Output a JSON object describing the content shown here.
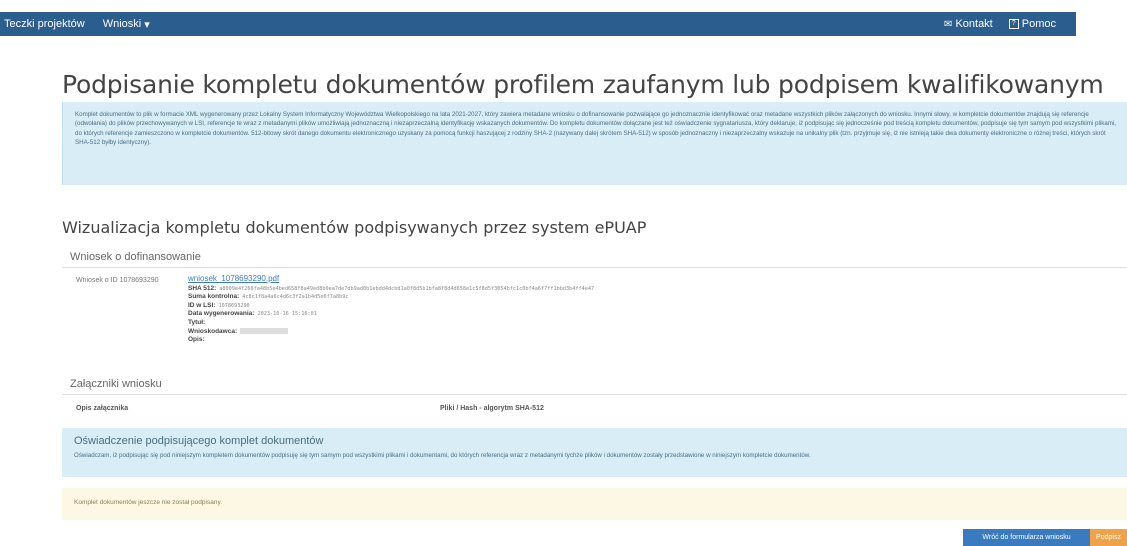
{
  "nav": {
    "left": [
      "Teczki projektów",
      "Wnioski"
    ],
    "wnioski_caret": "▾",
    "right": [
      {
        "icon": "envelope-icon",
        "label": "Kontakt"
      },
      {
        "icon": "help-box-icon",
        "label": "Pomoc"
      }
    ]
  },
  "page": {
    "title": "Podpisanie kompletu dokumentów profilem zaufanym lub podpisem kwalifikowanym przez ePUAP",
    "info": "Komplet dokumentów to plik w formacie XML wygenerowany przez Lokalny System Informatyczny Województwa Wielkopolskiego na lata 2021-2027, który zawiera metadane wniosku o dofinansowanie pozwalające go jednoznacznie identyfikować oraz metadane wszystkich plików załączonych do wniosku. Innymi słowy, w kompletcie dokumentów znajdują się referencje (odwołania) do plików przechowywanych w LSI, referencje te wraz z metadanymi plików umożliwiają jednoznaczną i niezaprzeczalną identyfikację wskazanych dokumentów. Do kompletu dokumentów dołączane jest też oświadczenie sygnatariusza, który deklaruje, iż podpisując się jednocześnie pod treścią kompletu dokumentów, podpisuje się tym samym pod wszystkimi plikami, do których referencje zamieszczono w kompletcie dokumentów. 512-bitowy skrót danego dokumentu elektronicznego uzyskany za pomocą funkcji haszującej z rodziny SHA-2 (nazywany dalej skrótem SHA-512) w sposób jednoznaczny i niezaprzeczalny wskazuje na unikalny plik (tzn. przyjmuje się, iż nie istnieją takie dwa dokumenty elektroniczne o różnej treści, których skrót SHA-512 byłby identyczny).",
    "subtitle": "Wizualizacja kompletu dokumentów podpisywanych przez system ePUAP"
  },
  "wniosek": {
    "heading": "Wniosek o dofinansowanie",
    "label": "Wniosek o ID 1078693290",
    "file": "wniosek_1078693290.pdf",
    "fields": [
      {
        "k": "SHA 512:",
        "v": "a8009e4f266fa48b5e4bed658f8a49ed8b0ea7de7db9ad0b1ebdd4dcbd1a0f8d5b1bfa8f8d4d658e1c5f8d5f3054bfc1c0bf4a6f7ff1bbd3b4ff4e47"
      },
      {
        "k": "Suma kontrolna:",
        "v": "4c8c1f8a4a6c4d6c3f2a1b4d5e6f7a8b9c"
      },
      {
        "k": "ID w LSI:",
        "v": "1078693290"
      },
      {
        "k": "Data wygenerowania:",
        "v": "2023-10-16 15:16:01"
      },
      {
        "k": "Tytuł:",
        "v": ""
      },
      {
        "k": "Wnioskodawca:",
        "v": ""
      },
      {
        "k": "Opis:",
        "v": ""
      }
    ]
  },
  "zalaczniki": {
    "heading": "Załączniki wniosku",
    "col1": "Opis załącznika",
    "col2": "Pliki / Hash - algorytm SHA-512"
  },
  "oswiadczenie": {
    "title": "Oświadczenie podpisującego komplet dokumentów",
    "text": "Oświadczam, iż podpisując się pod niniejszym kompletem dokumentów podpisuję się tym samym pod wszystkimi plikami i dokumentami, do których referencja wraz z metadanymi tychże plików i dokumentów zostały przedstawione w niniejszym kompletcie dokumentów."
  },
  "status": "Komplet dokumentów jeszcze nie został podpisany.",
  "buttons": {
    "back": "Wróć do formularza wniosku",
    "sign": "Podpisz"
  }
}
